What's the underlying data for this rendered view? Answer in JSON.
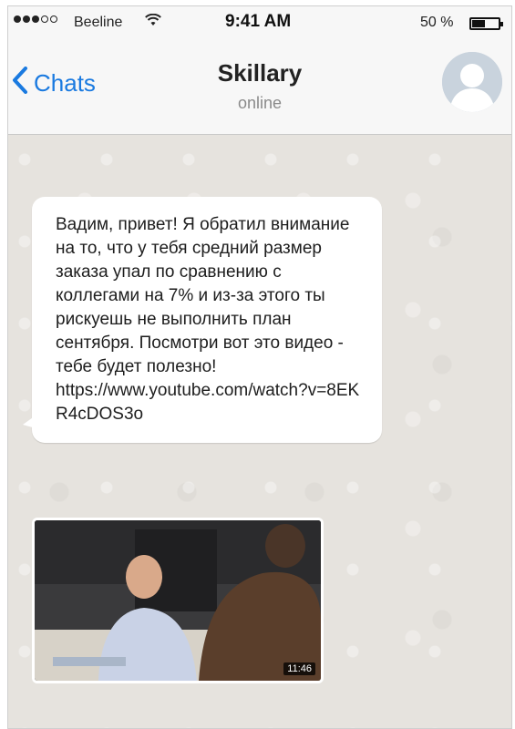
{
  "status_bar": {
    "carrier": "Beeline",
    "time": "9:41 AM",
    "battery": "50 %",
    "battery_level": 0.5
  },
  "nav": {
    "back_label": "Chats",
    "title": "Skillary",
    "status": "online"
  },
  "message": {
    "text": "Вадим, привет! Я обратил внимание на то, что у тебя средний размер заказа упал по сравнению с коллегами на 7% и из-за этого ты рискуешь не выполнить план сентября. Посмотри вот это видео - тебе будет полезно!",
    "link": "https://www.youtube.com/watch?v=8EKR4cDOS3o"
  },
  "video": {
    "duration": "11:46"
  },
  "colors": {
    "accent": "#1a7ae0",
    "chat_background": "#e6e3de",
    "bubble": "#ffffff"
  }
}
